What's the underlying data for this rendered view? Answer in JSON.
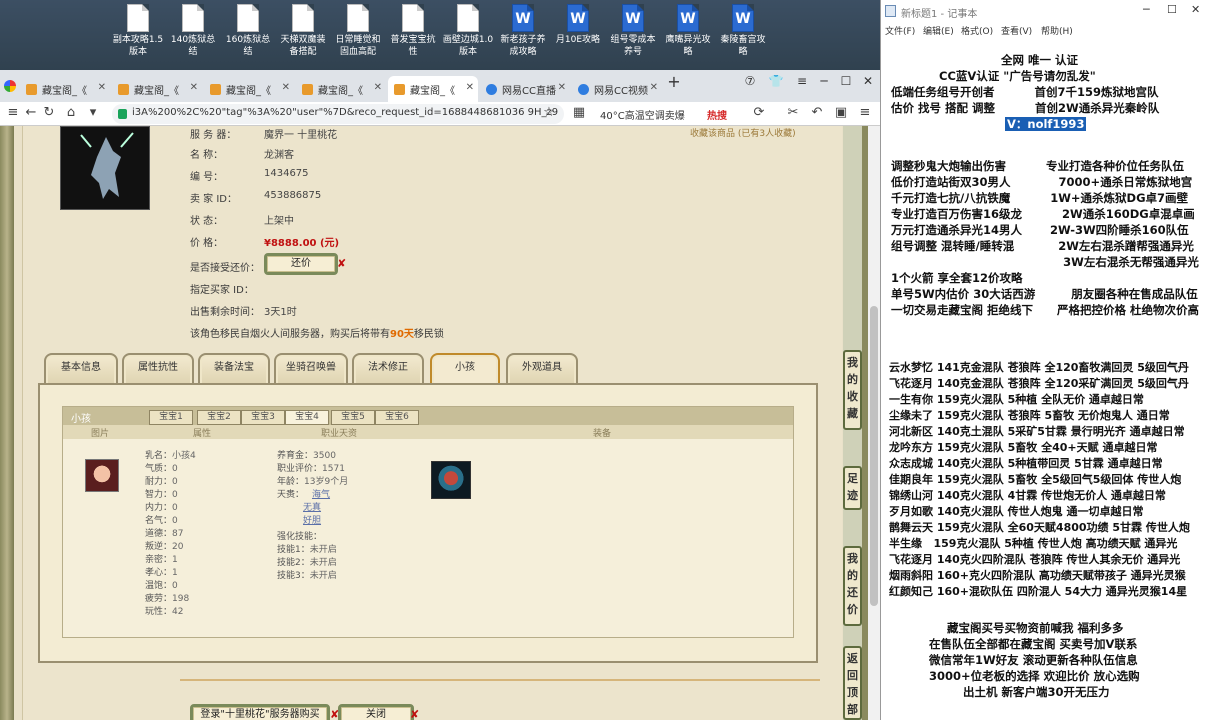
{
  "desktop": {
    "icons": [
      {
        "label": "副本攻略1.5版本",
        "type": "doc"
      },
      {
        "label": "140炼狱总结",
        "type": "doc"
      },
      {
        "label": "160炼狱总结",
        "type": "doc"
      },
      {
        "label": "天梯双魔装备搭配",
        "type": "doc"
      },
      {
        "label": "日常睡觉和固血高配",
        "type": "doc"
      },
      {
        "label": "普发宝宝抗性",
        "type": "doc"
      },
      {
        "label": "画壁边城1.0版本",
        "type": "doc"
      },
      {
        "label": "新老孩子养成攻略",
        "type": "word"
      },
      {
        "label": "月10E攻略",
        "type": "word"
      },
      {
        "label": "组号零成本养号",
        "type": "word"
      },
      {
        "label": "鹰嘴异光攻略",
        "type": "word"
      },
      {
        "label": "秦陵畜宫攻略",
        "type": "word"
      }
    ]
  },
  "browser": {
    "tabs": [
      {
        "label": "藏宝阁_《"
      },
      {
        "label": "藏宝阁_《"
      },
      {
        "label": "藏宝阁_《"
      },
      {
        "label": "藏宝阁_《"
      },
      {
        "label": "藏宝阁_《",
        "active": true
      },
      {
        "label": "网易CC直播"
      },
      {
        "label": "网易CC视频"
      }
    ],
    "new_tab": "+",
    "url": "i3A%200%2C%20\"tag\"%3A%20\"user\"%7D&reco_request_id=1688448681036 9H_z9",
    "weather": "40°C高温空调卖爆",
    "hot": "热搜"
  },
  "listing": {
    "server_label": "服 务 器：",
    "server_value": "魔界一 十里桃花",
    "name_label": "名        称：",
    "name_value": "龙渊客",
    "id_label": "编        号：",
    "id_value": "1434675",
    "seller_label": "卖   家   ID：",
    "seller_value": "453886875",
    "status_label": "状        态：",
    "status_value": "上架中",
    "price_label": "价        格：",
    "price_value": "¥8888.00 (元)",
    "counter_label": "是否接受还价：",
    "counter_button": "还价",
    "buyer_label": "指定买家 ID：",
    "time_label": "出售剩余时间：",
    "time_value": "3天1时",
    "notice_pre": "该角色移民自烟火人间服务器，购买后将带有",
    "notice_days": "90天",
    "notice_post": "移民锁",
    "fav_text": "收藏该商品 (已有3人收藏)"
  },
  "tabs": [
    "基本信息",
    "属性抗性",
    "装备法宝",
    "坐骑召唤兽",
    "法术修正",
    "小孩",
    "外观道具"
  ],
  "kid_panel": {
    "title": "小孩",
    "subtabs": [
      "宝宝1",
      "宝宝2",
      "宝宝3",
      "宝宝4",
      "宝宝5",
      "宝宝6"
    ],
    "col_headers": [
      "图片",
      "属性",
      "职业天资",
      "装备"
    ],
    "stats": [
      {
        "k": "乳名：",
        "v": "小孩4"
      },
      {
        "k": "气质：",
        "v": "0"
      },
      {
        "k": "耐力：",
        "v": "0"
      },
      {
        "k": "智力：",
        "v": "0"
      },
      {
        "k": "内力：",
        "v": "0"
      },
      {
        "k": "名气：",
        "v": "0"
      },
      {
        "k": "道德：",
        "v": "87"
      },
      {
        "k": "叛逆：",
        "v": "20"
      },
      {
        "k": "亲密：",
        "v": "1"
      },
      {
        "k": "孝心：",
        "v": "1"
      },
      {
        "k": "温饱：",
        "v": "0"
      },
      {
        "k": "疲劳：",
        "v": "198"
      },
      {
        "k": "玩性：",
        "v": "42"
      }
    ],
    "raise_label": "养育金：",
    "raise_value": "3500",
    "career_label": "职业评价：",
    "career_value": "1571",
    "age_label": "年龄：",
    "age_value": "13岁9个月",
    "talent_label": "天赉：",
    "talents": [
      "海气",
      "无真",
      "好胆"
    ],
    "skill_header": "强化技能：",
    "skills": [
      {
        "k": "技能1：",
        "v": "未开启"
      },
      {
        "k": "技能2：",
        "v": "未开启"
      },
      {
        "k": "技能3：",
        "v": "未开启"
      }
    ]
  },
  "bottom_buttons": {
    "login": "登录\"十里桃花\"服务器购买",
    "close": "关闭"
  },
  "sidebar": {
    "collect": "我的收藏",
    "footprint": "足迹",
    "bargain": "我的还价",
    "top": "返回顶部"
  },
  "notepad": {
    "title": "新标题1 - 记事本",
    "menu": [
      "文件(F)",
      "编辑(E)",
      "格式(O)",
      "查看(V)",
      "帮助(H)"
    ],
    "lines": [
      "全网 唯一 认证",
      "CC蓝V认证 \"广告号请勿乱发\"",
      "低端任务组号开创者          首创7千159炼狱地宫队",
      "估价 找号 搭配 调整          首创2W通杀异光秦岭队",
      "",
      "",
      "调整秒鬼大炮输出伤害          专业打造各种价位任务队伍",
      "低价打造站街双30男人            7000+通杀日常炼狱地宫",
      "千元打造七抗/八抗铁魔          1W+通杀炼狱DG卓7画壁",
      "专业打造百万伤害16级龙          2W通杀160DG卓混卓画",
      "万元打造通杀异光14男人       2W-3W四阶睡杀160队伍",
      "组号调整 混转睡/睡转混           2W左右混杀蹭帮强通异光",
      "                                           3W左右混杀无帮强通异光",
      "1个火箭 享全套12价攻略",
      "单号5W内估价 30大话西游         朋友圈各种在售成品队伍",
      "一切交易走藏宝阁 拒绝线下      严格把控价格 杜绝物次价高",
      "",
      "",
      "云水梦忆 141克金混队 苍狼阵 全120畜牧满回灵 5级回气丹",
      "飞花逐月 140克金混队 苍狼阵 全120采矿满回灵 5级回气丹",
      "一生有你 159克火混队 5种植 全队无价 通卓越日常",
      "尘缘未了 159克火混队 苍狼阵 5畜牧 无价炮鬼人 通日常",
      "河北新区 140克土混队 5采矿5甘霖 景行明光齐 通卓越日常",
      "龙吟东方 159克火混队 5畜牧 全40+天赋 通卓越日常",
      "众志成城 140克火混队 5种植带回灵 5甘霖 通卓越日常",
      "佳期良年 159克火混队 5畜牧 全5级回气5级回体 传世人炮",
      "锦绣山河 140克火混队 4甘霖 传世炮无价人 通卓越日常",
      "歹月如歌 140克火混队 传世人炮鬼 通一切卓越日常",
      "鹊舞云天 159克火混队 全60天赋4800功绩 5甘霖 传世人炮",
      "半生缘   159克火混队 5种植 传世人炮 高功绩天赋 通异光",
      "飞花逐月 140克火四阶混队 苍狼阵 传世人其余无价 通异光",
      "烟雨斜阳 160+克火四阶混队 高功绩天赋带孩子 通异光灵猴",
      "红颜知己 160+混砍队伍 四阶混人 54大力 通异光灵猴14星",
      "",
      "藏宝阁买号买物资前喊我 福利多多",
      "在售队伍全部都在藏宝阁 买卖号加V联系",
      "微信常年1W好友 滚动更新各种队伍信息",
      "3000+位老板的选择 欢迎比价 放心选购",
      "出土机 新客户端30开无压力"
    ],
    "vid": "V：nolf1993"
  }
}
